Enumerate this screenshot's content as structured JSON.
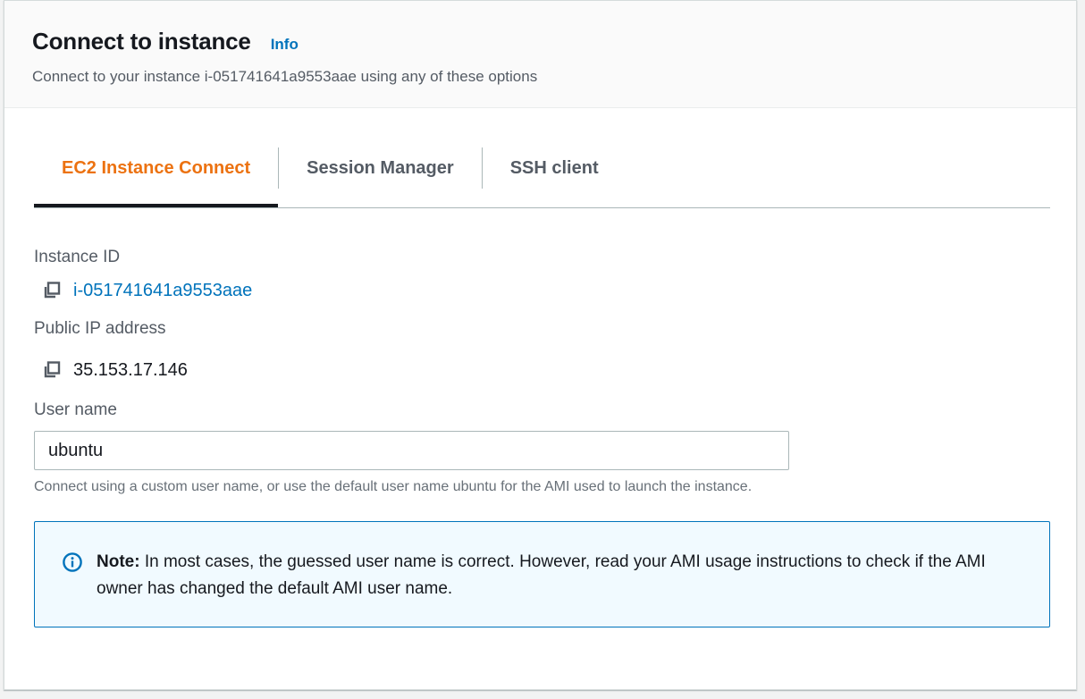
{
  "header": {
    "title": "Connect to instance",
    "info_label": "Info",
    "subtitle": "Connect to your instance i-051741641a9553aae using any of these options"
  },
  "tabs": [
    {
      "label": "EC2 Instance Connect",
      "active": true
    },
    {
      "label": "Session Manager",
      "active": false
    },
    {
      "label": "SSH client",
      "active": false
    }
  ],
  "instance": {
    "id_label": "Instance ID",
    "id_value": "i-051741641a9553aae",
    "ip_label": "Public IP address",
    "ip_value": "35.153.17.146"
  },
  "user": {
    "label": "User name",
    "value": "ubuntu",
    "hint": "Connect using a custom user name, or use the default user name ubuntu for the AMI used to launch the instance."
  },
  "note": {
    "strong": "Note:",
    "text": " In most cases, the guessed user name is correct. However, read your AMI usage instructions to check if the AMI owner has changed the default AMI user name."
  },
  "icons": {
    "copy": "copy-icon",
    "info": "info-circle-icon"
  },
  "colors": {
    "accent_orange": "#ec7211",
    "link_blue": "#0073bb",
    "note_background": "#f1faff"
  }
}
